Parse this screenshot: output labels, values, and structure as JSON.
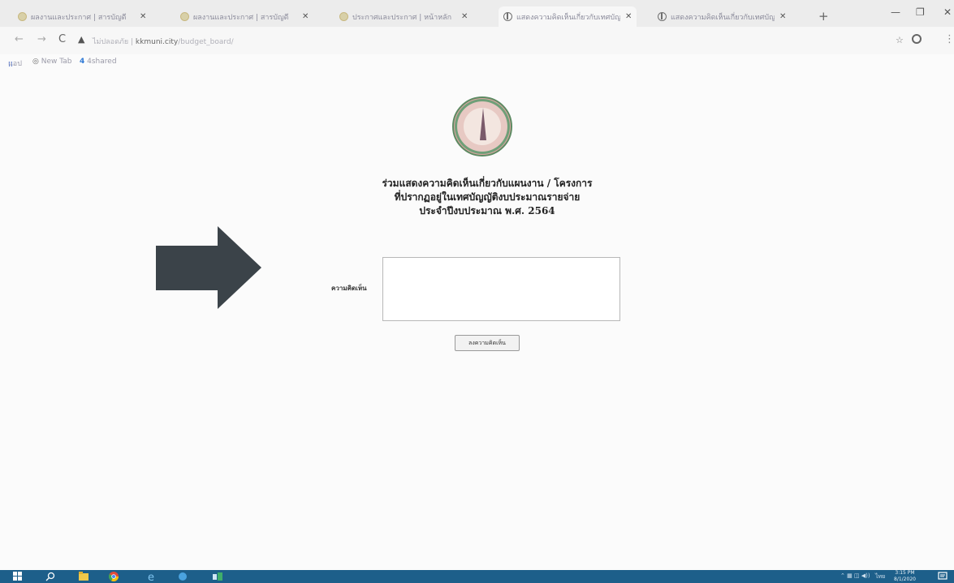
{
  "browser": {
    "tabs": [
      {
        "title": "ผลงานและประกาศ | สารบัญดี",
        "icon": "site-favicon"
      },
      {
        "title": "ผลงานและประกาศ | สารบัญดี",
        "icon": "site-favicon"
      },
      {
        "title": "ประกาศและประกาศ | หน้าหลัก",
        "icon": "site-favicon"
      },
      {
        "title": "แสดงความคิดเห็นเกี่ยวกับเทศบัญญัติ",
        "icon": "globe-icon"
      },
      {
        "title": "แสดงความคิดเห็นเกี่ยวกับเทศบัญญัติ",
        "icon": "globe-icon"
      }
    ],
    "security_label": "ไม่ปลอดภัย",
    "url_host": "kkmuni.city",
    "url_path": "/budget_board/"
  },
  "bookmarks": [
    "แอป",
    "New Tab",
    "4shared"
  ],
  "page": {
    "heading_lines": [
      "ร่วมแสดงความคิดเห็นเกี่ยวกับแผนงาน / โครงการ",
      "ที่ปรากฏอยู่ในเทศบัญญัติงบประมาณรายจ่าย",
      "ประจำปีงบประมาณ พ.ศ. 2564"
    ],
    "comment_label": "ความคิดเห็น",
    "comment_value": "",
    "submit_label": "ลงความคิดเห็น"
  },
  "taskbar": {
    "time": "3:15 PM",
    "date": "8/1/2020",
    "lang": "ไทย"
  },
  "colors": {
    "taskbar": "#1d5f8a",
    "arrow": "#3b4349"
  }
}
